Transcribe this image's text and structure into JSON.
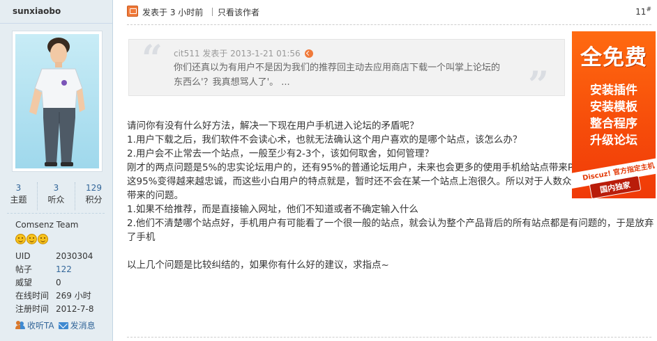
{
  "user": {
    "name": "sunxiaobo",
    "stats": [
      {
        "num": "3",
        "label": "主题"
      },
      {
        "num": "3",
        "label": "听众"
      },
      {
        "num": "129",
        "label": "积分"
      }
    ],
    "group": "Comsenz Team",
    "info": [
      {
        "key": "UID",
        "value": "2030304"
      },
      {
        "key": "帖子",
        "value": "122"
      },
      {
        "key": "威望",
        "value": "0"
      },
      {
        "key": "在线时间",
        "value": "269 小时"
      },
      {
        "key": "注册时间",
        "value": "2012-7-8"
      }
    ],
    "actions": {
      "follow": "收听TA",
      "message": "发消息"
    }
  },
  "post": {
    "time": "发表于  3 小时前",
    "only_author": "只看该作者",
    "floor": "11",
    "floor_suffix": "#",
    "quote": {
      "author_time": "cit511 发表于  2013-1-21 01:56",
      "text": "你们还真以为有用户不是因为我们的推荐回主动去应用商店下载一个叫掌上论坛的东西么'？我真想骂人了'。   ..."
    },
    "body": "请问你有没有什么好方法，解决一下现在用户手机进入论坛的矛盾呢？\n1.用户下载之后，我们软件不会读心术，也就无法确认这个用户喜欢的是哪个站点，该怎么办？\n2.用户会不止常去一个站点，一般至少有2-3个，该如何取舍，如何管理？\n刚才的两点问题是5%的忠实论坛用户的，还有95%的普通论坛用户，未来也会更多的使用手机给站点带来PV，站长也会希望这95%变得越来越忠诚，而这些小白用户的特点就是，暂时还不会在某一个站点上泡很久。所以对于人数众多的小白用户，就带来的问题。\n1.如果不给推荐，而是直接输入网址，他们不知道或者不确定输入什么\n2.他们不清楚哪个站点好，手机用户有可能看了一个很一般的站点，就会认为整个产品背后的所有站点都是有问题的，于是放弃了手机\n\n以上几个问题是比较纠结的，如果你有什么好的建议，求指点~"
  },
  "ad": {
    "title": "全免费",
    "lines": [
      "安装插件",
      "安装模板",
      "整合程序",
      "升级论坛"
    ],
    "band": "Discuz! 官方指定主机",
    "badge": "国内独家"
  },
  "colors": {
    "link": "#336699",
    "sidebar_bg": "#e5edf2",
    "ad_bg": "#f64b0a"
  }
}
